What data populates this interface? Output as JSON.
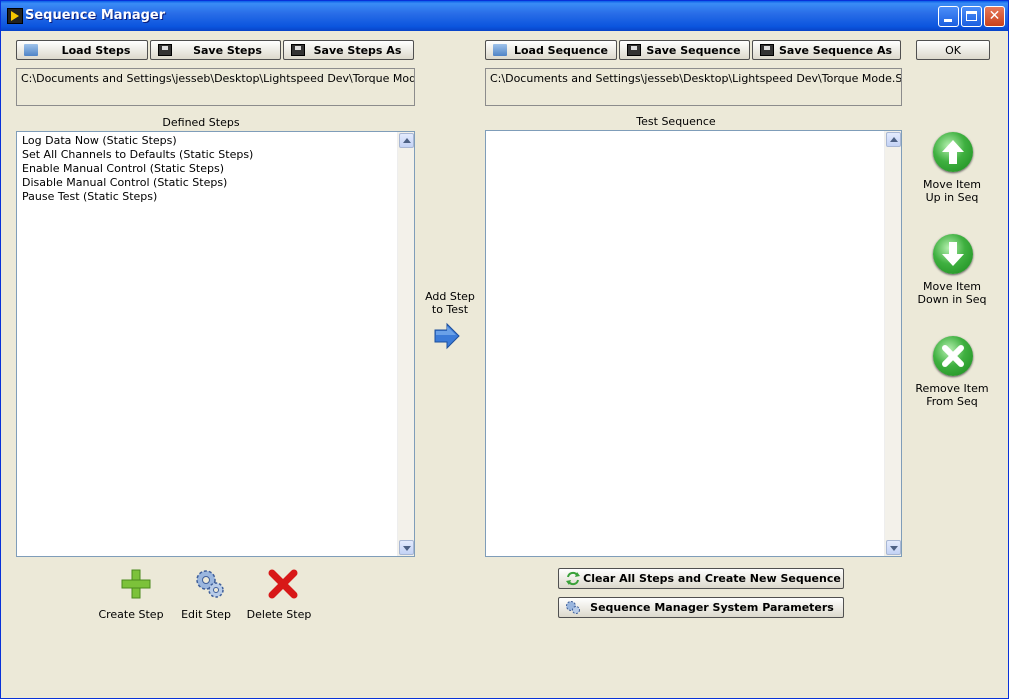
{
  "window": {
    "title": "Sequence Manager"
  },
  "toolbar_left": {
    "load_steps": "Load Steps",
    "save_steps": "Save Steps",
    "save_steps_as": "Save Steps As"
  },
  "toolbar_right": {
    "load_sequence": "Load Sequence",
    "save_sequence": "Save Sequence",
    "save_sequence_as": "Save Sequence As",
    "ok": "OK"
  },
  "paths": {
    "steps_path": "C:\\Documents and Settings\\jesseb\\Desktop\\Lightspeed Dev\\Torque Mode.Steps",
    "sequence_path": "C:\\Documents and Settings\\jesseb\\Desktop\\Lightspeed Dev\\Torque Mode.SEQ"
  },
  "defined_steps": {
    "caption": "Defined Steps",
    "items": [
      "Log Data Now (Static Steps)",
      "Set All Channels to Defaults (Static Steps)",
      "Enable Manual Control (Static Steps)",
      "Disable Manual Control (Static Steps)",
      "Pause Test (Static Steps)"
    ]
  },
  "test_sequence": {
    "caption": "Test Sequence",
    "items": []
  },
  "add_step": {
    "line1": "Add Step",
    "line2": "to Test"
  },
  "side_actions": {
    "move_up": {
      "line1": "Move Item",
      "line2": "Up in Seq"
    },
    "move_down": {
      "line1": "Move Item",
      "line2": "Down in Seq"
    },
    "remove": {
      "line1": "Remove Item",
      "line2": "From Seq"
    }
  },
  "step_tools": {
    "create": "Create Step",
    "edit": "Edit Step",
    "delete": "Delete Step"
  },
  "bottom_buttons": {
    "clear_all": "Clear All Steps and Create New Sequence",
    "system_params": "Sequence Manager System Parameters"
  },
  "icons": {
    "app": "labview-icon",
    "folder": "folder-icon",
    "floppy": "floppy-disk-icon",
    "arrow_right": "arrow-right-icon",
    "arrow_up": "arrow-up-icon",
    "arrow_down": "arrow-down-icon",
    "remove": "x-circle-icon",
    "plus": "plus-icon",
    "gears": "gears-icon",
    "delete": "red-x-icon",
    "refresh": "refresh-icon"
  },
  "colors": {
    "titlebar": "#0a5fe8",
    "window_bg": "#ece9d8",
    "accent_green": "#3fb040",
    "accent_blue": "#3b7bd8",
    "delete_red": "#d81818"
  }
}
